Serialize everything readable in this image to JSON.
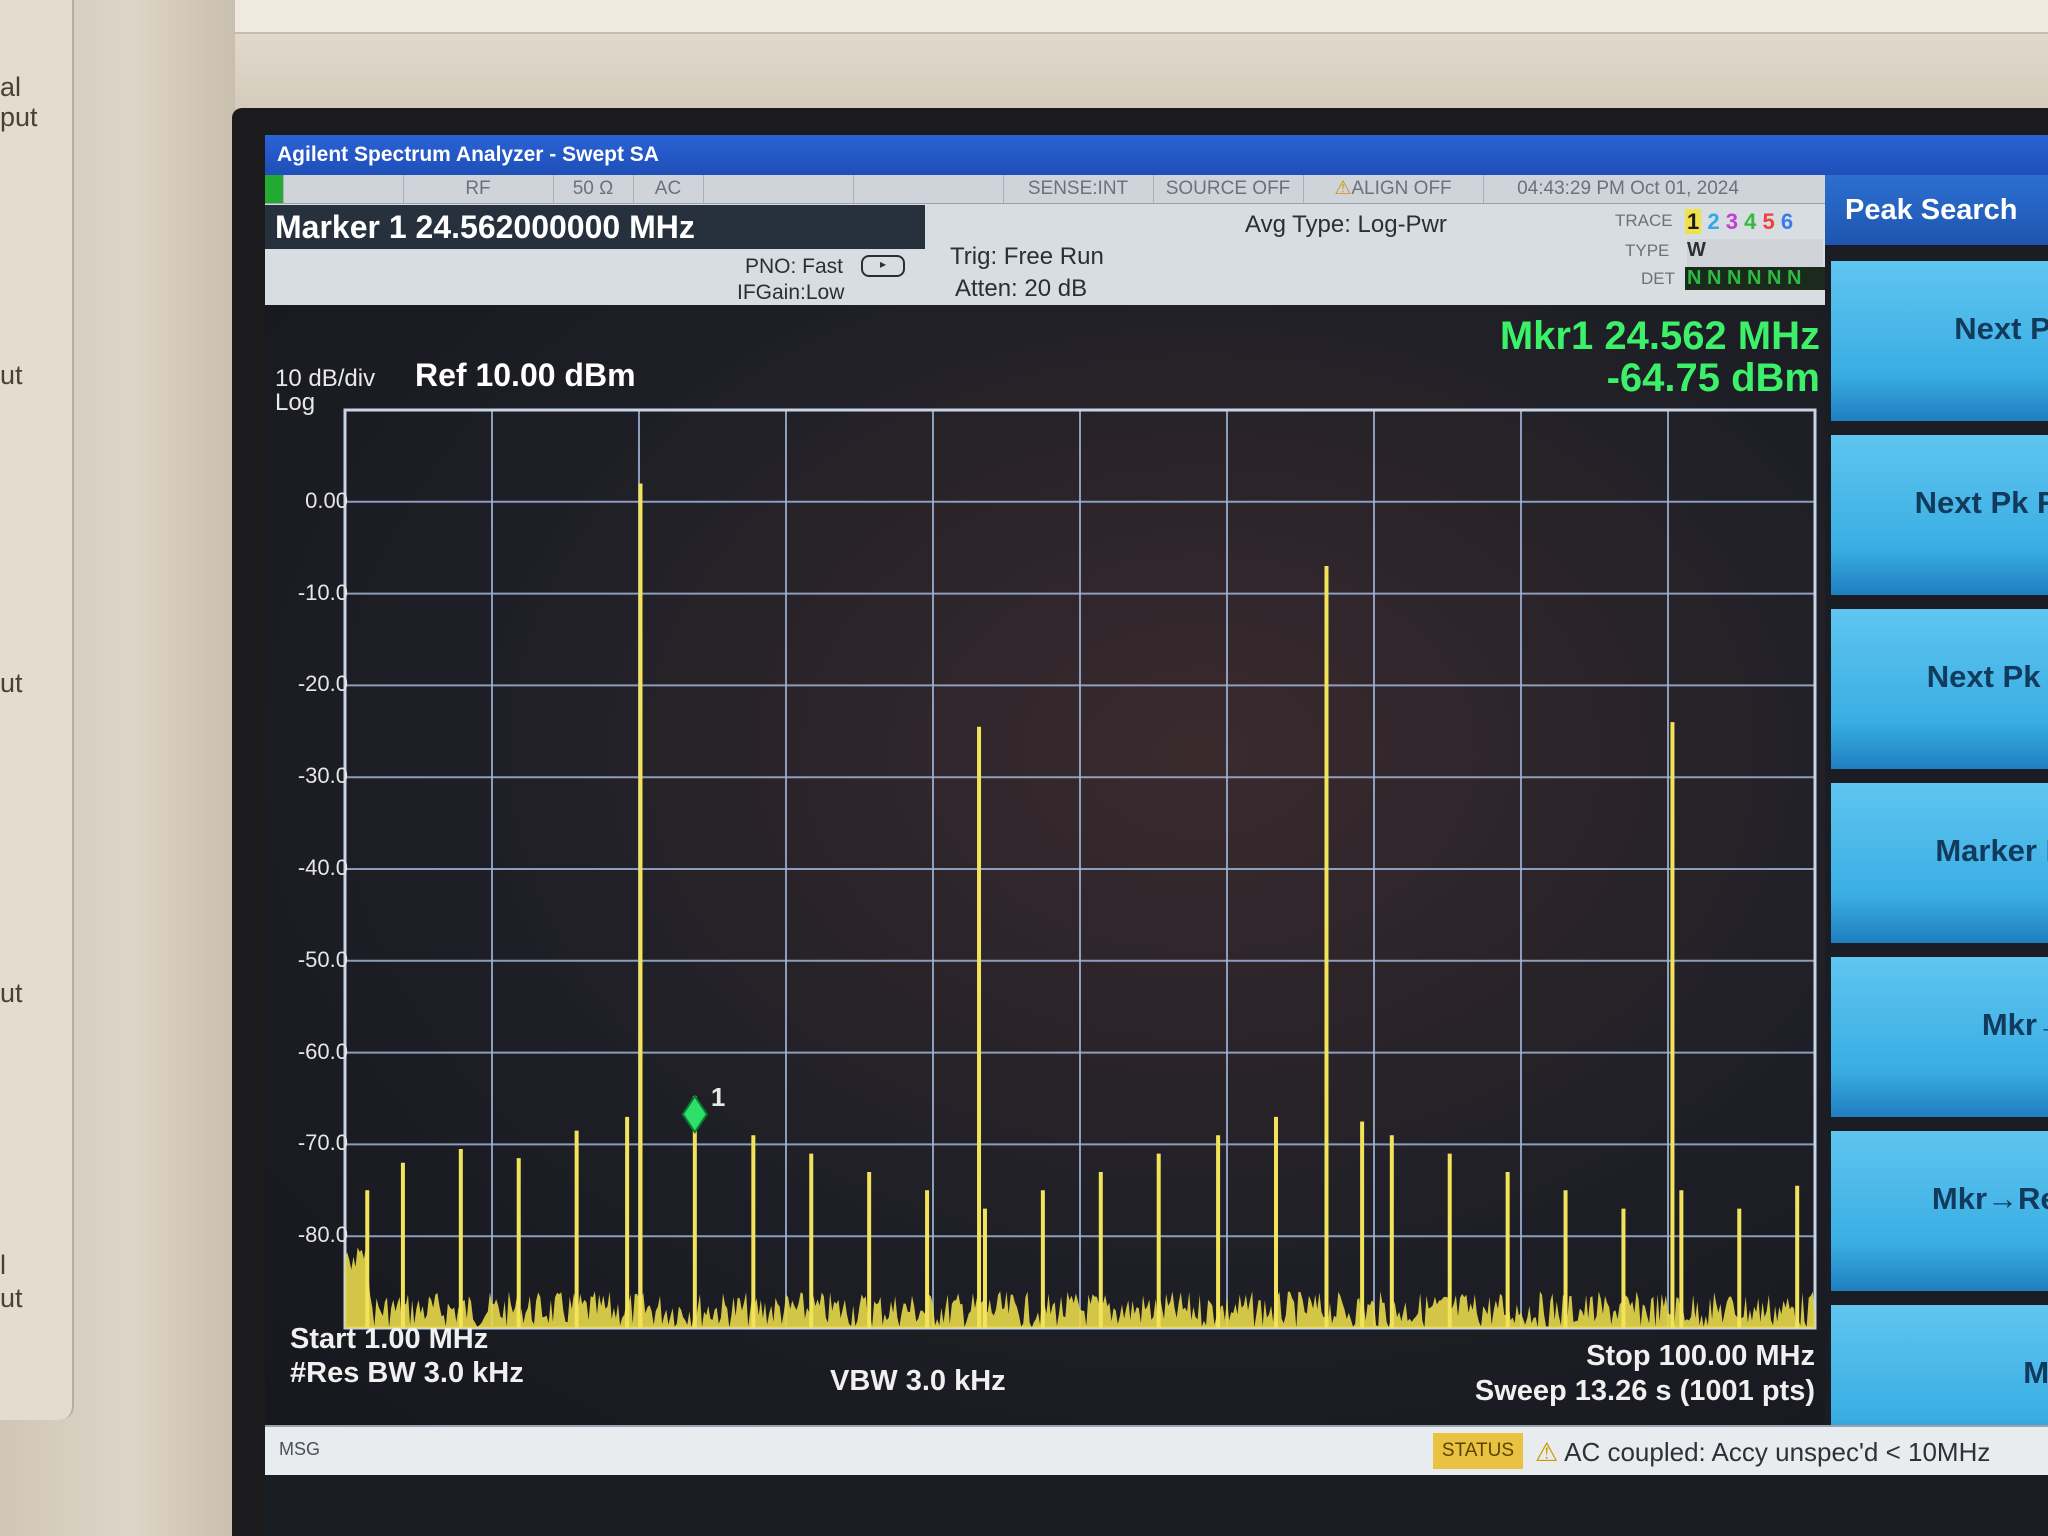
{
  "window": {
    "title": "Agilent Spectrum Analyzer - Swept SA"
  },
  "bezel": {
    "side_labels": [
      "al",
      "put",
      "ut",
      "ut",
      "ut",
      "l",
      "ut"
    ]
  },
  "header": {
    "row1": {
      "rf": "RF",
      "ohms": "50 Ω",
      "ac": "AC",
      "sense": "SENSE:INT",
      "source": "SOURCE OFF",
      "align": "ALIGN OFF",
      "datetime": "04:43:29 PM Oct 01, 2024"
    },
    "marker_title": "Marker 1 24.562000000 MHz",
    "pno": "PNO: Fast",
    "ifgain": "IFGain:Low",
    "trig": "Trig: Free Run",
    "atten": "Atten: 20 dB",
    "avg_type": "Avg Type: Log-Pwr",
    "trace_label": "TRACE",
    "type_label": "TYPE",
    "det_label": "DET",
    "trace_numbers": [
      "1",
      "2",
      "3",
      "4",
      "5",
      "6"
    ],
    "type_value": "W",
    "det_value": "N N N N N N",
    "trace_colors": [
      "#f0e04a",
      "#48c8ff",
      "#e050e0",
      "#50e050",
      "#ff5050",
      "#4a8aff"
    ]
  },
  "readout": {
    "mkr_freq": "Mkr1 24.562 MHz",
    "mkr_amp": "-64.75 dBm"
  },
  "scale": {
    "per_div": "10 dB/div",
    "ref": "Ref 10.00 dBm",
    "mode": "Log"
  },
  "footer": {
    "start": "Start 1.00 MHz",
    "res_bw": "#Res BW 3.0 kHz",
    "vbw": "VBW 3.0 kHz",
    "stop": "Stop 100.00 MHz",
    "sweep": "Sweep  13.26 s (1001 pts)"
  },
  "softkeys": {
    "title": "Peak Search",
    "items": [
      "Next Pe",
      "Next Pk Ri",
      "Next Pk L",
      "Marker D",
      "Mkr→",
      "Mkr→Ref",
      "Mo"
    ]
  },
  "status": {
    "msg": "MSG",
    "status_label": "STATUS",
    "text": "AC coupled: Accy unspec'd < 10MHz"
  },
  "chart_data": {
    "type": "line",
    "xlabel": "",
    "ylabel": "",
    "xlim": [
      1,
      100
    ],
    "ylim": [
      -90,
      10
    ],
    "y_ticks": [
      "0.00",
      "-10.0",
      "-20.0",
      "-30.0",
      "-40.0",
      "-50.0",
      "-60.0",
      "-70.0",
      "-80.0"
    ],
    "grid": true,
    "marker": {
      "label": "1",
      "x": 24.562,
      "y": -64.75
    },
    "peaks": [
      {
        "x": 20.9,
        "y": 2.0
      },
      {
        "x": 43.7,
        "y": -24.5
      },
      {
        "x": 67.1,
        "y": -7.0
      },
      {
        "x": 90.4,
        "y": -24.0
      },
      {
        "x": 20.9,
        "y": -58.0
      },
      {
        "x": 24.56,
        "y": -64.75
      },
      {
        "x": 2.5,
        "y": -75.0
      },
      {
        "x": 4.9,
        "y": -72.0
      },
      {
        "x": 8.8,
        "y": -70.5
      },
      {
        "x": 12.7,
        "y": -71.5
      },
      {
        "x": 16.6,
        "y": -68.5
      },
      {
        "x": 20.0,
        "y": -67.0
      },
      {
        "x": 28.5,
        "y": -69.0
      },
      {
        "x": 32.4,
        "y": -71.0
      },
      {
        "x": 36.3,
        "y": -73.0
      },
      {
        "x": 40.2,
        "y": -75.0
      },
      {
        "x": 44.1,
        "y": -77.0
      },
      {
        "x": 48.0,
        "y": -75.0
      },
      {
        "x": 51.9,
        "y": -73.0
      },
      {
        "x": 55.8,
        "y": -71.0
      },
      {
        "x": 59.8,
        "y": -69.0
      },
      {
        "x": 63.7,
        "y": -67.0
      },
      {
        "x": 69.5,
        "y": -67.5
      },
      {
        "x": 71.5,
        "y": -69.0
      },
      {
        "x": 75.4,
        "y": -71.0
      },
      {
        "x": 79.3,
        "y": -73.0
      },
      {
        "x": 83.2,
        "y": -75.0
      },
      {
        "x": 87.1,
        "y": -77.0
      },
      {
        "x": 91.0,
        "y": -75.0
      },
      {
        "x": 94.9,
        "y": -77.0
      },
      {
        "x": 98.8,
        "y": -74.5
      }
    ]
  }
}
